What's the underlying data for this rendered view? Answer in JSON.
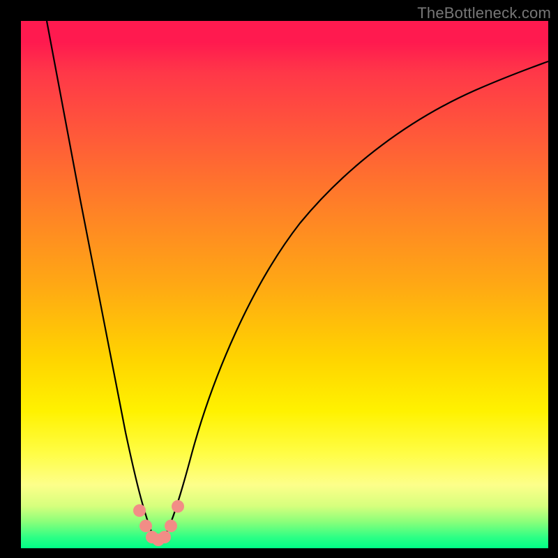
{
  "watermark": "TheBottleneck.com",
  "colors": {
    "frame": "#000000",
    "curve": "#000000",
    "marker": "#f28d86",
    "gradient_stops": [
      {
        "pos": 0,
        "hex": "#ff1a4f"
      },
      {
        "pos": 0.5,
        "hex": "#ffa814"
      },
      {
        "pos": 0.82,
        "hex": "#fffd45"
      },
      {
        "pos": 1.0,
        "hex": "#00ff86"
      }
    ]
  },
  "chart_data": {
    "type": "line",
    "title": "",
    "xlabel": "",
    "ylabel": "",
    "xlim": [
      0,
      100
    ],
    "ylim": [
      0,
      100
    ],
    "x": [
      5,
      10,
      15,
      18,
      20,
      22,
      24,
      25,
      26,
      27,
      28,
      30,
      32,
      35,
      40,
      45,
      50,
      55,
      60,
      65,
      70,
      75,
      80,
      85,
      90,
      95,
      100
    ],
    "values": [
      100,
      78,
      52,
      34,
      22,
      10,
      3,
      0,
      0,
      1,
      4,
      12,
      22,
      35,
      50,
      59,
      66,
      71,
      75,
      78,
      81,
      83,
      85,
      87,
      88,
      89,
      90
    ],
    "minimum_x": 25.5,
    "markers_x": [
      22.5,
      24,
      25,
      26,
      27,
      28,
      29.5
    ],
    "markers_y": [
      6,
      2,
      0,
      0,
      1,
      3,
      8
    ]
  }
}
